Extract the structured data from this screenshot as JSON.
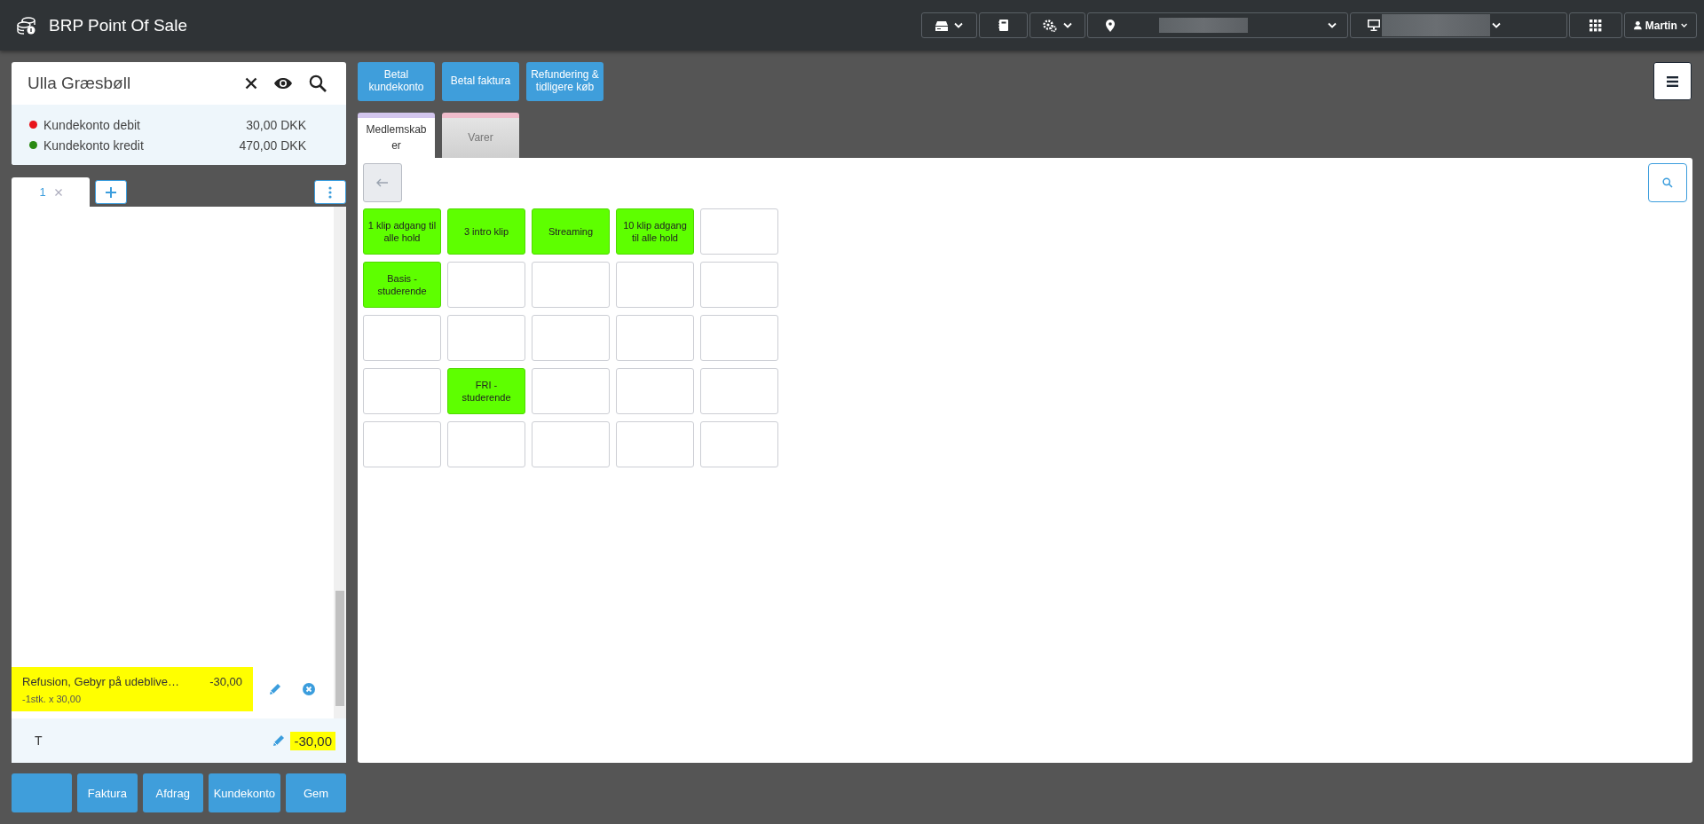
{
  "app": {
    "title": "BRP Point Of Sale"
  },
  "toolbar": [
    {
      "kind": "drawer",
      "dropdown": true
    },
    {
      "kind": "book",
      "dropdown": false
    },
    {
      "kind": "settings",
      "dropdown": true
    },
    {
      "kind": "location",
      "dropdown": true
    },
    {
      "kind": "terminal",
      "dropdown": true
    },
    {
      "kind": "apps",
      "dropdown": false
    },
    {
      "kind": "user",
      "dropdown": true,
      "label": "Martin"
    }
  ],
  "customer": {
    "name": "Ulla Græsbøll",
    "accounts": [
      {
        "label": "Kundekonto debit",
        "amount": "30,00 DKK",
        "color": "#e8141b"
      },
      {
        "label": "Kundekonto kredit",
        "amount": "470,00 DKK",
        "color": "#2a8a13"
      }
    ]
  },
  "cart_tabs": [
    {
      "label": "1",
      "selected": true
    }
  ],
  "cart_lines": [
    {
      "text": "Refusion, Gebyr på udeblive…",
      "amount": "-30,00",
      "detail": "-1stk. x 30,00",
      "highlighted": true
    }
  ],
  "total": {
    "label": "T",
    "amount": "-30,00",
    "highlighted": true
  },
  "action_buttons": [
    "Betal kundekonto",
    "Betal faktura",
    "Refundering & tidligere køb"
  ],
  "category_tabs": [
    {
      "label": "Medlemskaber",
      "selected": true,
      "color": "#d3c6ee"
    },
    {
      "label": "Varer",
      "selected": false,
      "color": "#f0bccb"
    }
  ],
  "products": [
    {
      "kind": "product",
      "label": "1 klip adgang til alle hold"
    },
    {
      "kind": "product",
      "label": "3 intro klip"
    },
    {
      "kind": "product",
      "label": "Streaming"
    },
    {
      "kind": "product",
      "label": "10 klip adgang til alle hold"
    },
    {
      "kind": "empty"
    },
    {
      "kind": "product",
      "label": "Basis - studerende"
    },
    {
      "kind": "empty"
    },
    {
      "kind": "empty"
    },
    {
      "kind": "empty"
    },
    {
      "kind": "empty"
    },
    {
      "kind": "empty"
    },
    {
      "kind": "empty"
    },
    {
      "kind": "empty"
    },
    {
      "kind": "empty"
    },
    {
      "kind": "empty"
    },
    {
      "kind": "empty"
    },
    {
      "kind": "product",
      "label": "FRI - studerende"
    },
    {
      "kind": "empty"
    },
    {
      "kind": "empty"
    },
    {
      "kind": "empty"
    },
    {
      "kind": "empty"
    },
    {
      "kind": "empty"
    },
    {
      "kind": "empty"
    },
    {
      "kind": "empty"
    },
    {
      "kind": "empty"
    }
  ],
  "bottom_buttons": [
    {
      "kind": "blank"
    },
    {
      "kind": "labeled",
      "label": "Faktura"
    },
    {
      "kind": "labeled",
      "label": "Afdrag"
    },
    {
      "kind": "labeled",
      "label": "Kundekonto"
    },
    {
      "kind": "labeled",
      "label": "Gem"
    }
  ]
}
